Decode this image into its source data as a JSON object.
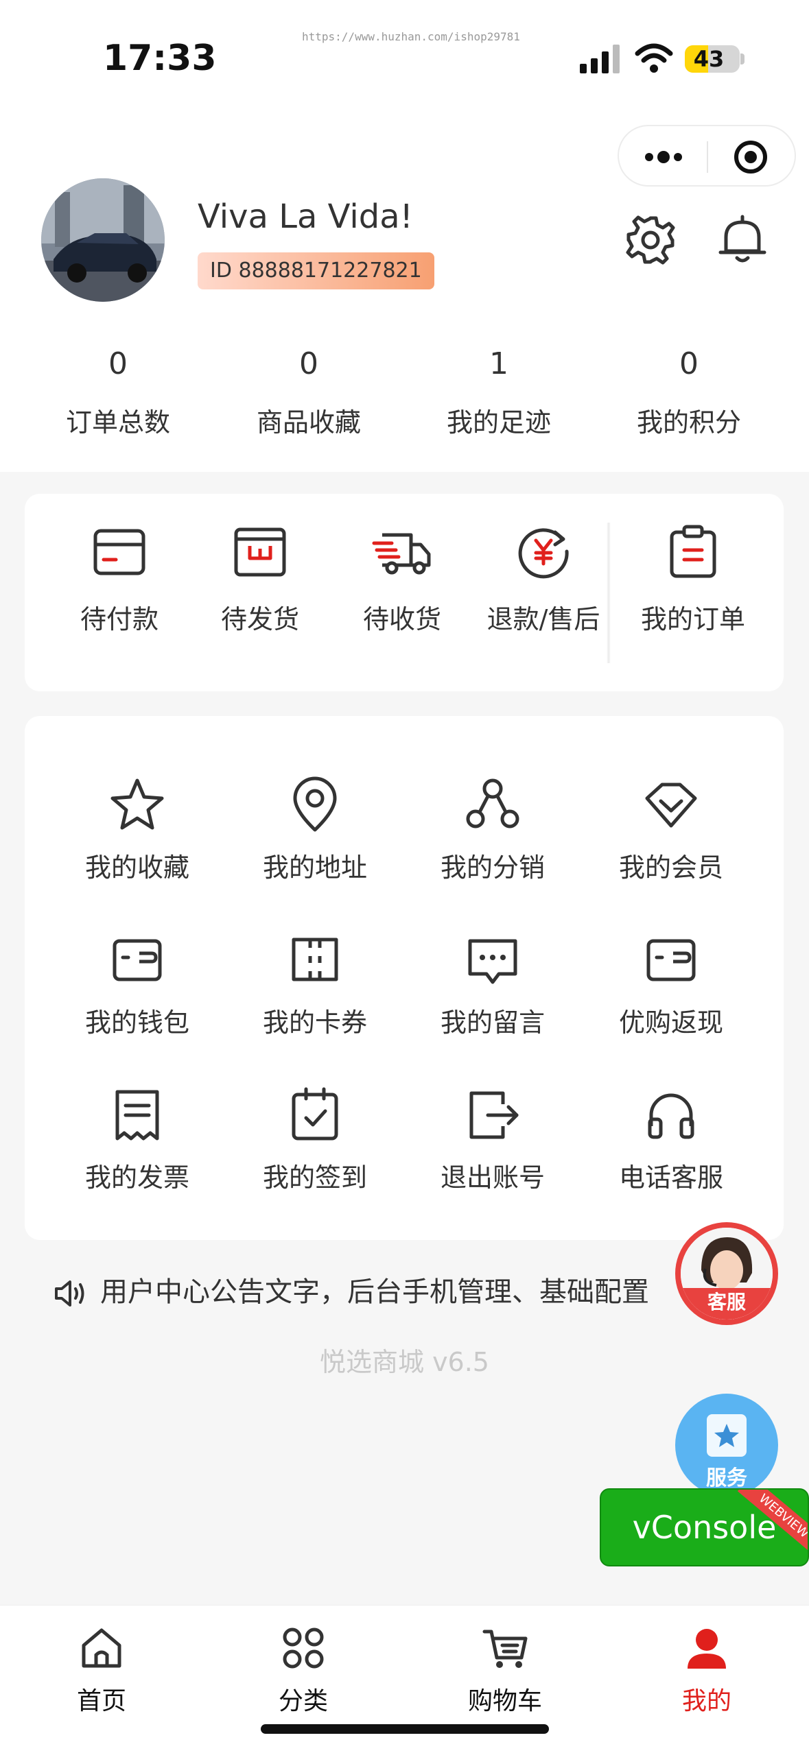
{
  "status_bar": {
    "time": "17:33",
    "url_watermark": "https://www.huzhan.com/ishop29781",
    "battery": "43",
    "battery_level": 0.43
  },
  "capsule": {
    "more_icon": "more-dots-icon",
    "close_icon": "target-close-icon"
  },
  "profile": {
    "name": "Viva La Vida!",
    "id_label": "ID 88888171227821",
    "settings_icon": "gear-icon",
    "bell_icon": "bell-icon"
  },
  "stats": [
    {
      "value": "0",
      "label": "订单总数"
    },
    {
      "value": "0",
      "label": "商品收藏"
    },
    {
      "value": "1",
      "label": "我的足迹"
    },
    {
      "value": "0",
      "label": "我的积分"
    }
  ],
  "orders": {
    "items": [
      {
        "label": "待付款",
        "icon": "wallet-card-icon"
      },
      {
        "label": "待发货",
        "icon": "box-w-icon"
      },
      {
        "label": "待收货",
        "icon": "delivery-truck-icon"
      },
      {
        "label": "退款/售后",
        "icon": "refund-yen-icon"
      }
    ],
    "all": {
      "label": "我的订单",
      "icon": "clipboard-icon"
    }
  },
  "services": [
    {
      "label": "我的收藏",
      "icon": "star-icon"
    },
    {
      "label": "我的地址",
      "icon": "location-pin-icon"
    },
    {
      "label": "我的分销",
      "icon": "share-nodes-icon"
    },
    {
      "label": "我的会员",
      "icon": "diamond-icon"
    },
    {
      "label": "我的钱包",
      "icon": "wallet-icon"
    },
    {
      "label": "我的卡券",
      "icon": "coupon-icon"
    },
    {
      "label": "我的留言",
      "icon": "message-icon"
    },
    {
      "label": "优购返现",
      "icon": "cashback-wallet-icon"
    },
    {
      "label": "我的发票",
      "icon": "invoice-icon"
    },
    {
      "label": "我的签到",
      "icon": "checkin-calendar-icon"
    },
    {
      "label": "退出账号",
      "icon": "logout-icon"
    },
    {
      "label": "电话客服",
      "icon": "headset-icon"
    }
  ],
  "notice": {
    "text": "用户中心公告文字，后台手机管理、基础配置",
    "icon": "speaker-icon"
  },
  "version": "悦选商城 v6.5",
  "floating": {
    "kefu_label": "客服",
    "fuwu_label": "服务",
    "vconsole_label": "vConsole",
    "vconsole_ribbon": "WEBVIEW"
  },
  "tabbar": [
    {
      "label": "首页",
      "icon": "home-icon"
    },
    {
      "label": "分类",
      "icon": "category-grid-icon"
    },
    {
      "label": "购物车",
      "icon": "cart-icon"
    },
    {
      "label": "我的",
      "icon": "user-icon"
    }
  ],
  "colors": {
    "accent": "#e0201c",
    "badge_from": "#ffd9cc",
    "badge_to": "#f7a072",
    "vconsole": "#1aad19",
    "fuwu": "#5ab4f2"
  }
}
